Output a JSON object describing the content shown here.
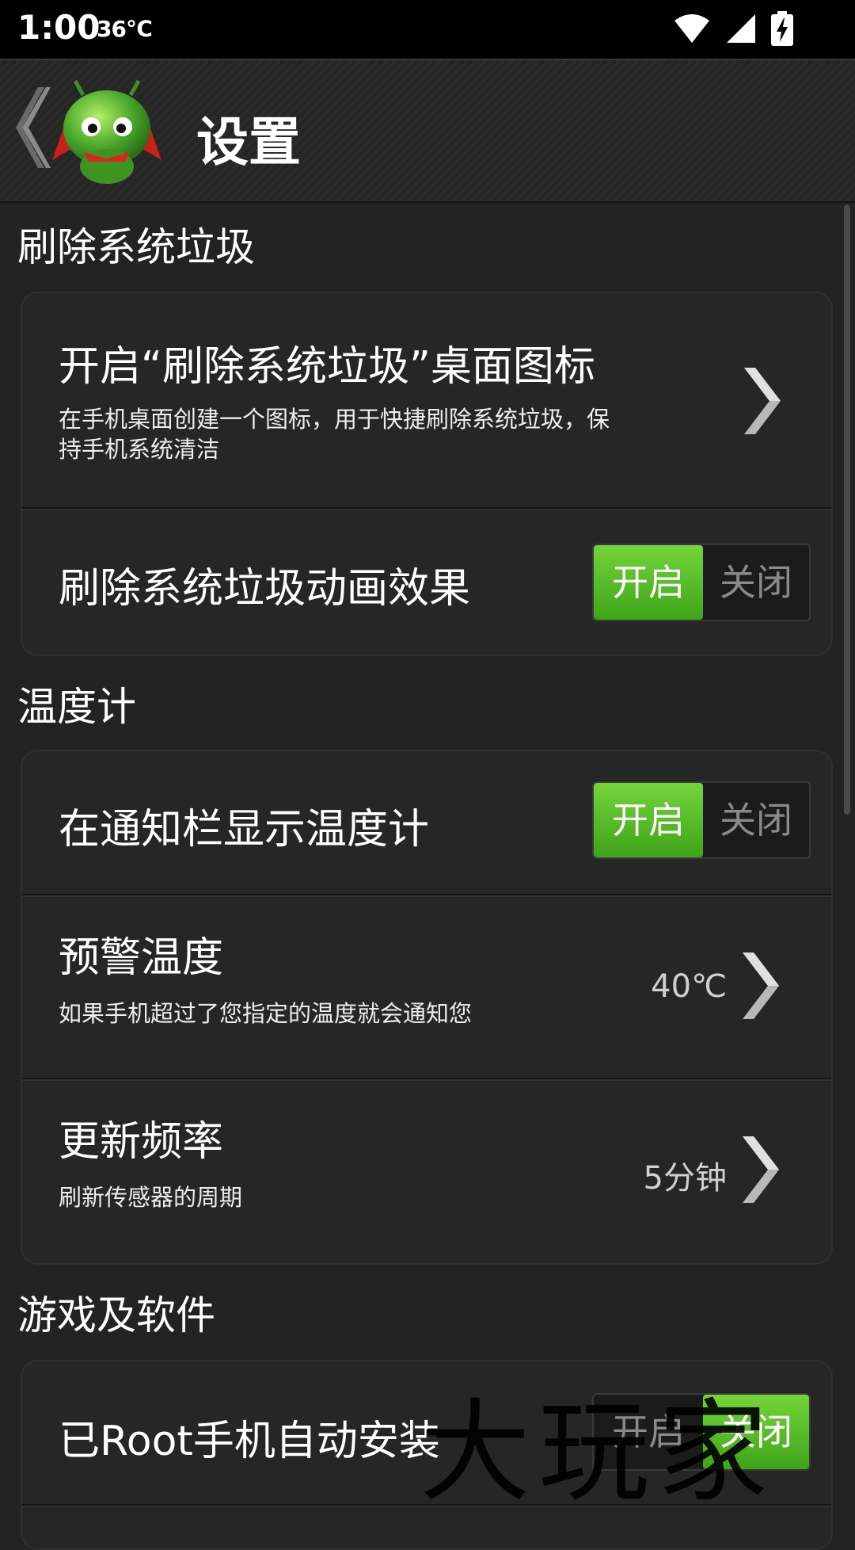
{
  "status_bar": {
    "time": "1:00",
    "temperature": "36℃",
    "icons": [
      "wifi-icon",
      "signal-icon",
      "battery-charging-icon"
    ]
  },
  "header": {
    "title": "设置",
    "back_icon": "back-arrow-icon",
    "logo": "android-mascot-logo"
  },
  "sections": [
    {
      "header": "刷除系统垃圾",
      "items": [
        {
          "title": "开启“刷除系统垃圾”桌面图标",
          "description": "在手机桌面创建一个图标，用于快捷刷除系统垃圾，保持手机系统清洁",
          "type": "link"
        },
        {
          "title": "刷除系统垃圾动画效果",
          "type": "toggle",
          "on_label": "开启",
          "off_label": "关闭",
          "state": "on"
        }
      ]
    },
    {
      "header": "温度计",
      "items": [
        {
          "title": "在通知栏显示温度计",
          "type": "toggle",
          "on_label": "开启",
          "off_label": "关闭",
          "state": "on"
        },
        {
          "title": "预警温度",
          "description": "如果手机超过了您指定的温度就会通知您",
          "value": "40℃",
          "type": "link"
        },
        {
          "title": "更新频率",
          "description": "刷新传感器的周期",
          "value": "5分钟",
          "type": "link"
        }
      ]
    },
    {
      "header": "游戏及软件",
      "items": [
        {
          "title": "已Root手机自动安装",
          "type": "toggle",
          "on_label": "开启",
          "off_label": "关闭",
          "state": "off"
        }
      ]
    }
  ],
  "watermark": "大玩家",
  "colors": {
    "background": "#232323",
    "toggle_on": "#4cb624",
    "card": "#262626"
  }
}
